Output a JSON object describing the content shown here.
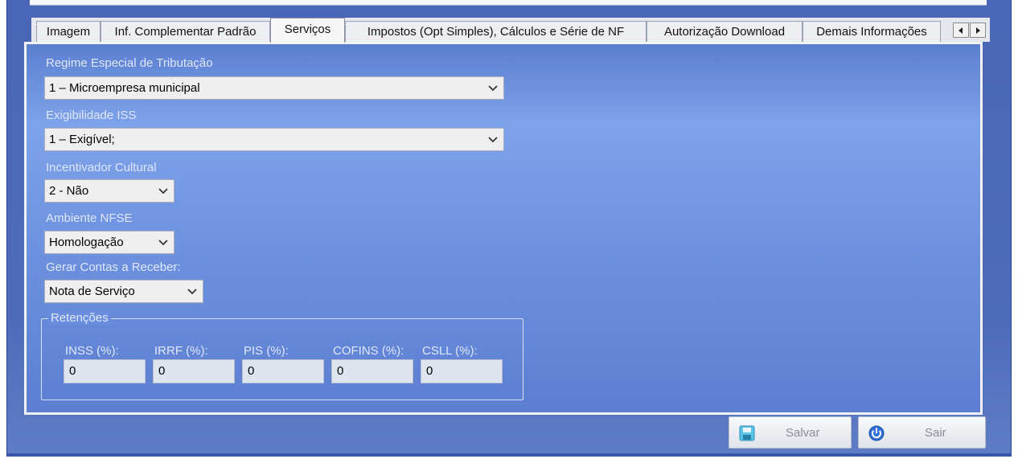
{
  "tabs": [
    {
      "label": "Imagem",
      "active": false
    },
    {
      "label": "Inf. Complementar Padrão",
      "active": false
    },
    {
      "label": "Serviços",
      "active": true
    },
    {
      "label": "Impostos (Opt Simples), Cálculos e Série de NF",
      "active": false
    },
    {
      "label": "Autorização Download",
      "active": false
    },
    {
      "label": "Demais Informações",
      "active": false
    }
  ],
  "tab_nav": {
    "prev_icon": "triangle-left-icon",
    "next_icon": "triangle-right-icon"
  },
  "servicos": {
    "regime": {
      "label": "Regime Especial de Tributação",
      "value": "1 – Microempresa municipal"
    },
    "exigibilidade": {
      "label": "Exigibilidade ISS",
      "value": "1 – Exigível;"
    },
    "incentivador": {
      "label": "Incentivador Cultural",
      "value": "2 - Não"
    },
    "ambiente": {
      "label": "Ambiente NFSE",
      "value": "Homologação"
    },
    "contas": {
      "label": "Gerar Contas a Receber:",
      "value": "Nota de Serviço"
    }
  },
  "retencoes": {
    "title": "Retenções",
    "fields": [
      {
        "label": "INSS (%):",
        "value": "0"
      },
      {
        "label": "IRRF (%):",
        "value": "0"
      },
      {
        "label": "PIS (%):",
        "value": "0"
      },
      {
        "label": "COFINS (%):",
        "value": "0"
      },
      {
        "label": "CSLL (%):",
        "value": "0"
      }
    ]
  },
  "buttons": {
    "save": "Salvar",
    "exit": "Sair"
  },
  "icons": {
    "save": "floppy-disk-icon",
    "exit": "power-icon"
  },
  "colors": {
    "window": "#4e6bb9",
    "panel": "#7ea3ea",
    "tab_active": "#f7f7f7"
  }
}
